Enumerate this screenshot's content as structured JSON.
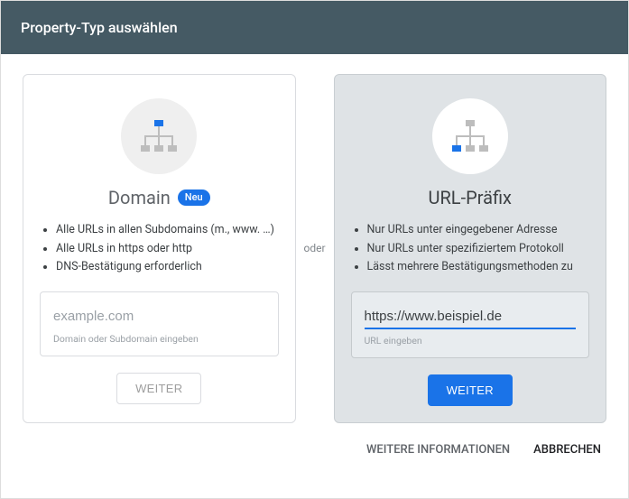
{
  "header": {
    "title": "Property-Typ auswählen"
  },
  "divider_label": "oder",
  "cards": {
    "domain": {
      "title": "Domain",
      "badge": "Neu",
      "bullets": [
        "Alle URLs in allen Subdomains (m., www. …)",
        "Alle URLs in https oder http",
        "DNS-Bestätigung erforderlich"
      ],
      "input_placeholder": "example.com",
      "input_helper": "Domain oder Subdomain eingeben",
      "button": "WEITER"
    },
    "urlprefix": {
      "title": "URL-Präfix",
      "bullets": [
        "Nur URLs unter eingegebener Adresse",
        "Nur URLs unter spezifiziertem Protokoll",
        "Lässt mehrere Bestätigungsmethoden zu"
      ],
      "input_value": "https://www.beispiel.de",
      "input_helper": "URL eingeben",
      "button": "WEITER"
    }
  },
  "footer": {
    "more_info": "WEITERE INFORMATIONEN",
    "cancel": "ABBRECHEN"
  },
  "colors": {
    "accent": "#1a73e8",
    "header_bg": "#455a64"
  }
}
